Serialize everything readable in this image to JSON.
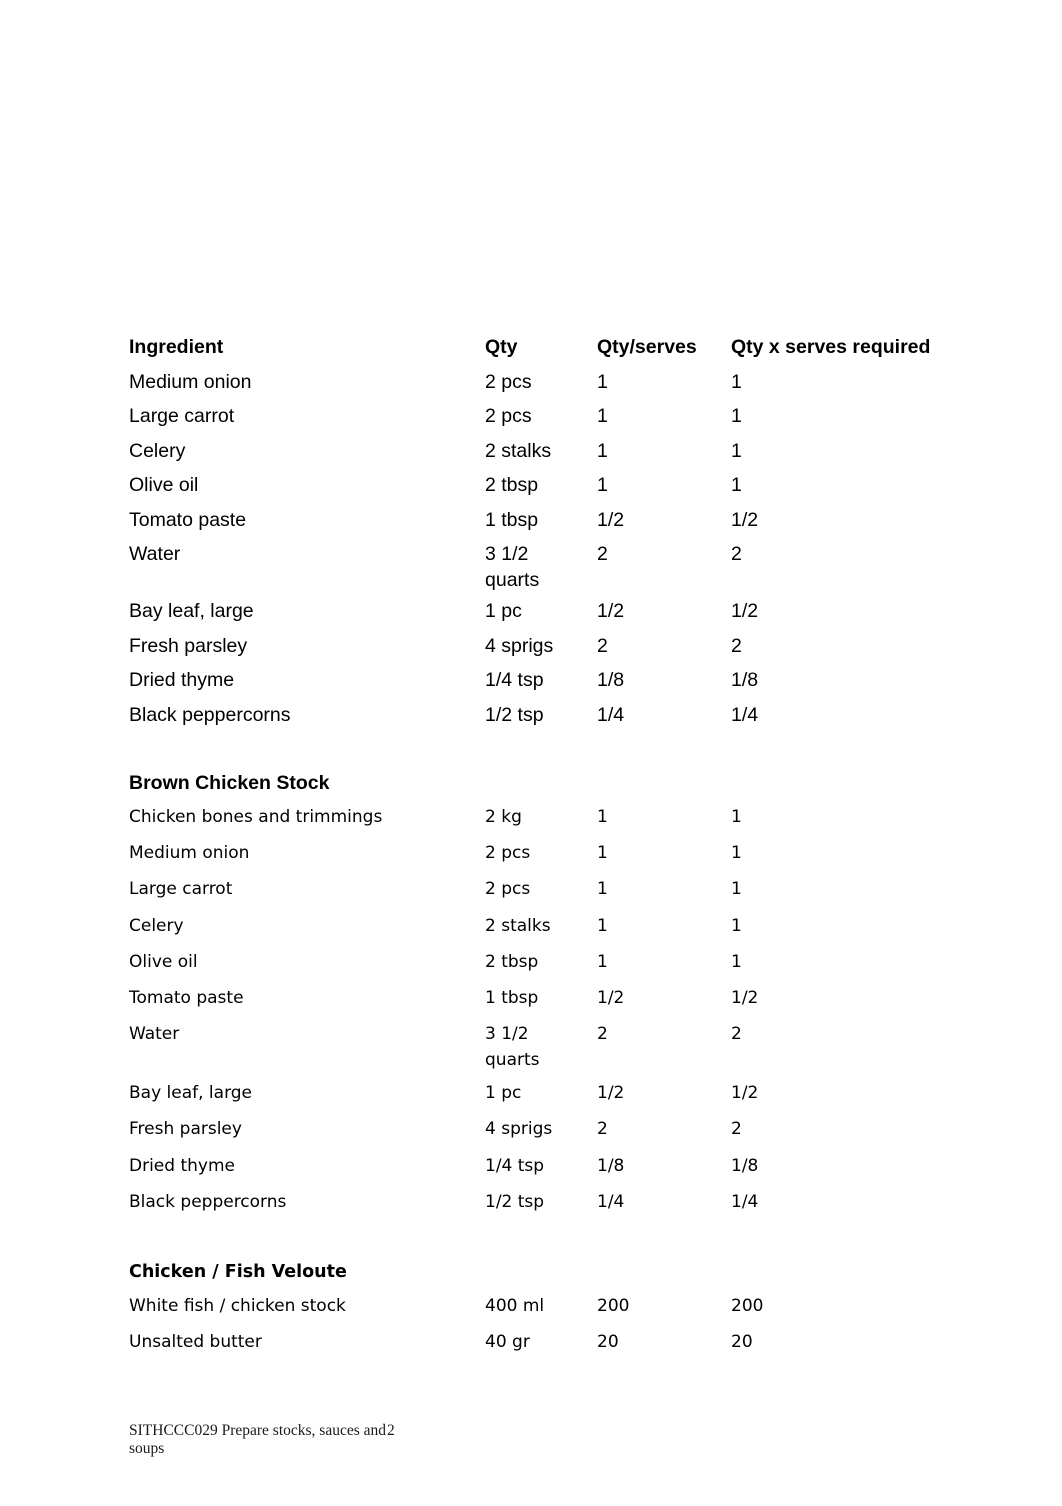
{
  "document": {
    "columns": {
      "ingredient": "Ingredient",
      "qty": "Qty",
      "qty_per_serves": "Qty/serves",
      "qty_x_serves_required": "Qty x serves required"
    },
    "sections": [
      {
        "heading": "",
        "rows": [
          {
            "ingredient": "Medium onion",
            "qty": "2 pcs",
            "qty_per_serves": "1",
            "qty_x_serves": "1"
          },
          {
            "ingredient": "Large carrot",
            "qty": "2 pcs",
            "qty_per_serves": "1",
            "qty_x_serves": "1"
          },
          {
            "ingredient": "Celery",
            "qty": "2 stalks",
            "qty_per_serves": "1",
            "qty_x_serves": "1"
          },
          {
            "ingredient": "Olive oil",
            "qty": "2 tbsp",
            "qty_per_serves": "1",
            "qty_x_serves": "1"
          },
          {
            "ingredient": "Tomato paste",
            "qty": "1 tbsp",
            "qty_per_serves": "1/2",
            "qty_x_serves": "1/2"
          },
          {
            "ingredient": "Water",
            "qty": "3 1/2\nquarts",
            "qty_per_serves": "2",
            "qty_x_serves": "2"
          },
          {
            "ingredient": "Bay leaf, large",
            "qty": "1 pc",
            "qty_per_serves": "1/2",
            "qty_x_serves": "1/2"
          },
          {
            "ingredient": "Fresh parsley",
            "qty": "4 sprigs",
            "qty_per_serves": "2",
            "qty_x_serves": "2"
          },
          {
            "ingredient": "Dried thyme",
            "qty": "1/4 tsp",
            "qty_per_serves": "1/8",
            "qty_x_serves": "1/8"
          },
          {
            "ingredient": "Black peppercorns",
            "qty": "1/2 tsp",
            "qty_per_serves": "1/4",
            "qty_x_serves": "1/4"
          }
        ]
      },
      {
        "heading": "Brown Chicken Stock",
        "rows": [
          {
            "ingredient": "Chicken bones and trimmings",
            "qty": "2 kg",
            "qty_per_serves": "1",
            "qty_x_serves": "1"
          },
          {
            "ingredient": "Medium onion",
            "qty": "2 pcs",
            "qty_per_serves": "1",
            "qty_x_serves": "1"
          },
          {
            "ingredient": "Large carrot",
            "qty": "2 pcs",
            "qty_per_serves": "1",
            "qty_x_serves": "1"
          },
          {
            "ingredient": "Celery",
            "qty": "2 stalks",
            "qty_per_serves": "1",
            "qty_x_serves": "1"
          },
          {
            "ingredient": "Olive oil",
            "qty": "2 tbsp",
            "qty_per_serves": "1",
            "qty_x_serves": "1"
          },
          {
            "ingredient": "Tomato paste",
            "qty": "1 tbsp",
            "qty_per_serves": "1/2",
            "qty_x_serves": "1/2"
          },
          {
            "ingredient": "Water",
            "qty": "3 1/2\nquarts",
            "qty_per_serves": "2",
            "qty_x_serves": "2"
          },
          {
            "ingredient": "Bay leaf, large",
            "qty": "1 pc",
            "qty_per_serves": "1/2",
            "qty_x_serves": "1/2"
          },
          {
            "ingredient": "Fresh parsley",
            "qty": "4 sprigs",
            "qty_per_serves": "2",
            "qty_x_serves": "2"
          },
          {
            "ingredient": "Dried thyme",
            "qty": "1/4 tsp",
            "qty_per_serves": "1/8",
            "qty_x_serves": "1/8"
          },
          {
            "ingredient": "Black peppercorns",
            "qty": "1/2 tsp",
            "qty_per_serves": "1/4",
            "qty_x_serves": "1/4"
          }
        ]
      },
      {
        "heading": "Chicken / Fish Veloute",
        "rows": [
          {
            "ingredient": "White fish / chicken stock",
            "qty": "400 ml",
            "qty_per_serves": "200",
            "qty_x_serves": "200"
          },
          {
            "ingredient": "Unsalted butter",
            "qty": "40 gr",
            "qty_per_serves": "20",
            "qty_x_serves": "20"
          }
        ]
      }
    ]
  },
  "footer": {
    "text": "SITHCCC029 Prepare stocks, sauces and soups",
    "page_number": "2"
  }
}
